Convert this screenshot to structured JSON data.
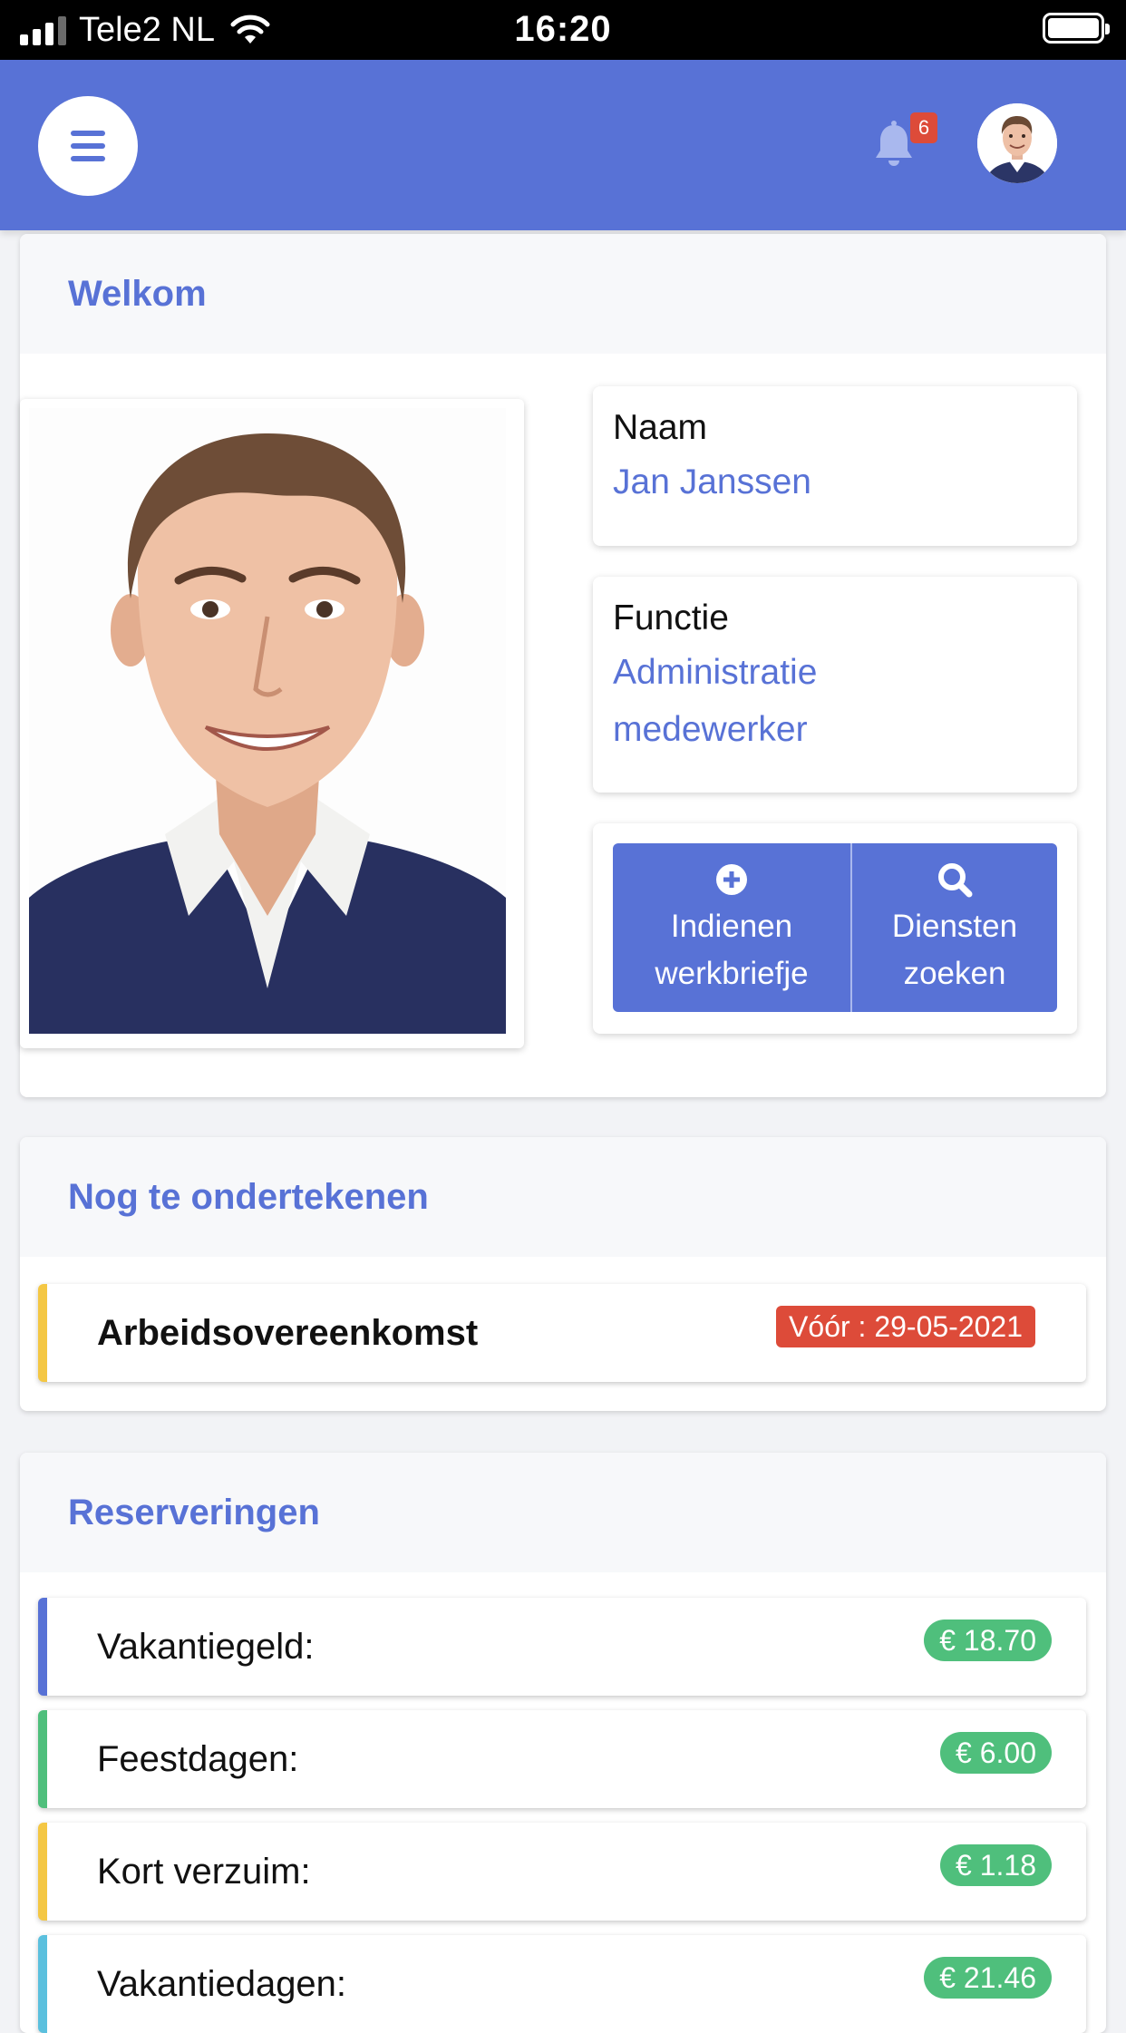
{
  "status_bar": {
    "carrier": "Tele2 NL",
    "time": "16:20"
  },
  "header": {
    "notification_count": "6"
  },
  "welcome": {
    "title": "Welkom",
    "name_label": "Naam",
    "name_value": "Jan Janssen",
    "function_label": "Functie",
    "function_value_line1": "Administratie",
    "function_value_line2": "medewerker",
    "actions": [
      {
        "line1": "Indienen",
        "line2": "werkbriefje",
        "icon": "plus-circle-icon"
      },
      {
        "line1": "Diensten",
        "line2": "zoeken",
        "icon": "search-icon"
      }
    ]
  },
  "to_sign": {
    "title": "Nog te ondertekenen",
    "items": [
      {
        "label": "Arbeidsovereenkomst",
        "deadline": "Vóór : 29-05-2021",
        "accent": "#f4c744"
      }
    ]
  },
  "reservations": {
    "title": "Reserveringen",
    "items": [
      {
        "label": "Vakantiegeld:",
        "amount": "€ 18.70",
        "accent": "#5872d6"
      },
      {
        "label": "Feestdagen:",
        "amount": "€ 6.00",
        "accent": "#4fbf7c"
      },
      {
        "label": "Kort verzuim:",
        "amount": "€ 1.18",
        "accent": "#f4c744"
      },
      {
        "label": "Vakantiedagen:",
        "amount": "€ 21.46",
        "accent": "#5bc0de"
      }
    ]
  },
  "colors": {
    "primary": "#5872d6",
    "danger": "#dd4b39",
    "success": "#4fbf7c"
  }
}
